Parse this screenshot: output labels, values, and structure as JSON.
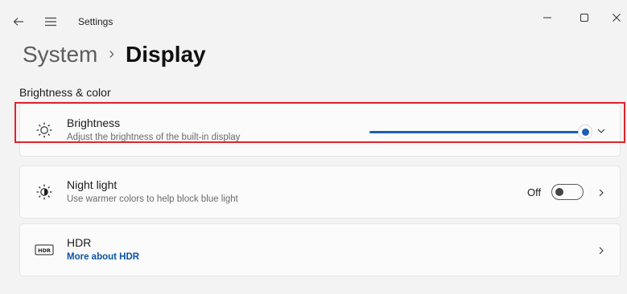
{
  "window": {
    "title": "Settings"
  },
  "breadcrumb": {
    "parent": "System",
    "separator": "›",
    "current": "Display"
  },
  "section": {
    "title": "Brightness & color"
  },
  "brightness": {
    "title": "Brightness",
    "description": "Adjust the brightness of the built-in display",
    "value_percent": 100
  },
  "night_light": {
    "title": "Night light",
    "description": "Use warmer colors to help block blue light",
    "state_label": "Off",
    "enabled": false
  },
  "hdr": {
    "title": "HDR",
    "link": "More about HDR",
    "icon_text": "HDR"
  },
  "colors": {
    "accent": "#1a5fb4",
    "highlight": "#e0242b",
    "link": "#0a54a8"
  },
  "icons": {
    "back": "back-arrow-icon",
    "menu": "hamburger-icon",
    "minimize": "minimize-icon",
    "maximize": "maximize-icon",
    "close": "close-icon",
    "brightness": "sun-icon",
    "night_light": "night-light-icon",
    "hdr": "hdr-icon",
    "expand": "chevron-down-icon",
    "navigate": "chevron-right-icon"
  }
}
